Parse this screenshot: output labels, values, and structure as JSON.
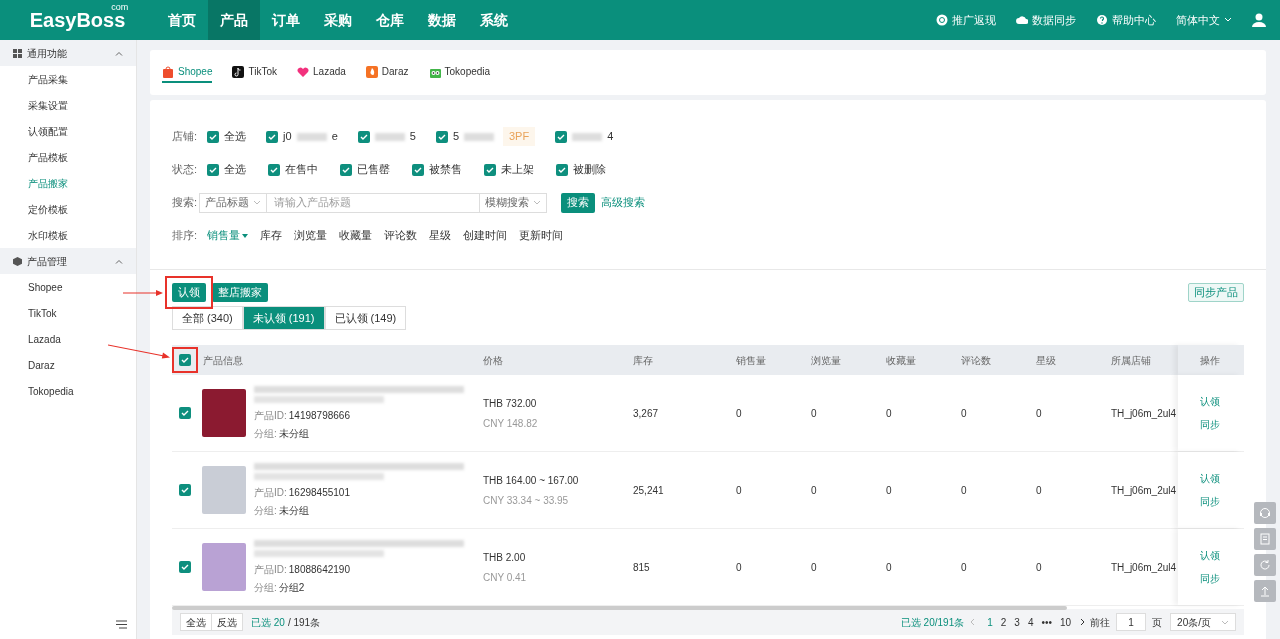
{
  "header": {
    "logo": "EasyBoss",
    "logo_suffix": "com",
    "nav": [
      {
        "label": "首页",
        "selected": false
      },
      {
        "label": "产品",
        "selected": true
      },
      {
        "label": "订单",
        "selected": false
      },
      {
        "label": "采购",
        "selected": false
      },
      {
        "label": "仓库",
        "selected": false
      },
      {
        "label": "数据",
        "selected": false
      },
      {
        "label": "系统",
        "selected": false
      }
    ],
    "actions": [
      {
        "kind": "coin",
        "label": "推广返现"
      },
      {
        "kind": "cloud",
        "label": "数据同步"
      },
      {
        "kind": "help",
        "label": "帮助中心"
      }
    ],
    "language": "简体中文"
  },
  "sidebar": {
    "groups": [
      {
        "kind": "grid",
        "label": "通用功能",
        "expanded": true,
        "items": [
          {
            "label": "产品采集",
            "selected": false
          },
          {
            "label": "采集设置",
            "selected": false
          },
          {
            "label": "认领配置",
            "selected": false
          },
          {
            "label": "产品模板",
            "selected": false
          },
          {
            "label": "产品搬家",
            "selected": true
          },
          {
            "label": "定价模板",
            "selected": false
          },
          {
            "label": "水印模板",
            "selected": false
          }
        ]
      },
      {
        "kind": "box",
        "label": "产品管理",
        "expanded": true,
        "items": [
          {
            "label": "Shopee",
            "selected": false
          },
          {
            "label": "TikTok",
            "selected": false
          },
          {
            "label": "Lazada",
            "selected": false
          },
          {
            "label": "Daraz",
            "selected": false
          },
          {
            "label": "Tokopedia",
            "selected": false
          }
        ]
      }
    ]
  },
  "platforms": [
    {
      "kind": "shopee",
      "label": "Shopee",
      "selected": true
    },
    {
      "kind": "tiktok",
      "label": "TikTok",
      "selected": false
    },
    {
      "kind": "lazada",
      "label": "Lazada",
      "selected": false
    },
    {
      "kind": "daraz",
      "label": "Daraz",
      "selected": false
    },
    {
      "kind": "tokopedia",
      "label": "Tokopedia",
      "selected": false
    }
  ],
  "filters": {
    "shop_label": "店铺:",
    "shops": [
      {
        "label": "全选",
        "checked": true,
        "blurred": false
      },
      {
        "label": "j0",
        "tail": "e",
        "checked": true,
        "blurred": true
      },
      {
        "tail": "5",
        "checked": true,
        "blurred": true
      },
      {
        "label": "5",
        "badge": "3PF",
        "checked": true,
        "blurred": true
      },
      {
        "tail": "4",
        "checked": true,
        "blurred": true
      }
    ],
    "status_label": "状态:",
    "statuses": [
      {
        "label": "全选",
        "checked": true
      },
      {
        "label": "在售中",
        "checked": true
      },
      {
        "label": "已售罄",
        "checked": true
      },
      {
        "label": "被禁售",
        "checked": true
      },
      {
        "label": "未上架",
        "checked": true
      },
      {
        "label": "被删除",
        "checked": true
      }
    ],
    "search_label": "搜索:",
    "search_field": "产品标题",
    "search_placeholder": "请输入产品标题",
    "search_mode": "模糊搜索",
    "search_button": "搜索",
    "advanced_link": "高级搜索",
    "sort_label": "排序:",
    "sorts": [
      {
        "label": "销售量",
        "selected": true
      },
      {
        "label": "库存",
        "selected": false
      },
      {
        "label": "浏览量",
        "selected": false
      },
      {
        "label": "收藏量",
        "selected": false
      },
      {
        "label": "评论数",
        "selected": false
      },
      {
        "label": "星级",
        "selected": false
      },
      {
        "label": "创建时间",
        "selected": false
      },
      {
        "label": "更新时间",
        "selected": false
      }
    ]
  },
  "toolbar": {
    "buttons": [
      "认领",
      "整店搬家"
    ],
    "sync_button": "同步产品"
  },
  "highlights": {
    "claim_button": true,
    "select_all_checkbox": true
  },
  "claim_tabs": [
    {
      "label": "全部 (340)",
      "selected": false
    },
    {
      "label": "未认领 (191)",
      "selected": true
    },
    {
      "label": "已认领 (149)",
      "selected": false
    }
  ],
  "table": {
    "all_checked": true,
    "columns": [
      "产品信息",
      "价格",
      "库存",
      "销售量",
      "浏览量",
      "收藏量",
      "评论数",
      "星级",
      "所属店铺",
      "操作"
    ],
    "rows": [
      {
        "checked": true,
        "id_label": "产品ID:",
        "id": "14198798666",
        "group_label": "分组:",
        "group": "未分组",
        "price": "THB 732.00",
        "price_cny": "CNY 148.82",
        "stock": "3,267",
        "sales": "0",
        "views": "0",
        "favorites": "0",
        "reviews": "0",
        "rating": "0",
        "shop": "TH_j06m_2ul4",
        "actions": [
          "认领",
          "同步"
        ]
      },
      {
        "checked": true,
        "id_label": "产品ID:",
        "id": "16298455101",
        "group_label": "分组:",
        "group": "未分组",
        "price": "THB 164.00 ~ 167.00",
        "price_cny": "CNY 33.34 ~ 33.95",
        "stock": "25,241",
        "sales": "0",
        "views": "0",
        "favorites": "0",
        "reviews": "0",
        "rating": "0",
        "shop": "TH_j06m_2ul4",
        "actions": [
          "认领",
          "同步"
        ]
      },
      {
        "checked": true,
        "id_label": "产品ID:",
        "id": "18088642190",
        "group_label": "分组:",
        "group": "分组2",
        "price": "THB 2.00",
        "price_cny": "CNY 0.41",
        "stock": "815",
        "sales": "0",
        "views": "0",
        "favorites": "0",
        "reviews": "0",
        "rating": "0",
        "shop": "TH_j06m_2ul4",
        "actions": [
          "认领",
          "同步"
        ]
      }
    ]
  },
  "footer": {
    "select_all": "全选",
    "invert": "反选",
    "selected_count": "已选 20",
    "total": "/ 191条",
    "page_summary": "已选 20/191条",
    "pages": [
      {
        "label": "1",
        "selected": true
      },
      {
        "label": "2",
        "selected": false
      },
      {
        "label": "3",
        "selected": false
      },
      {
        "label": "4",
        "selected": false
      },
      {
        "label": "•••",
        "selected": false
      },
      {
        "label": "10",
        "selected": false
      }
    ],
    "goto_label": "前往",
    "goto_value": "1",
    "page_unit": "页",
    "page_size": "20条/页"
  }
}
